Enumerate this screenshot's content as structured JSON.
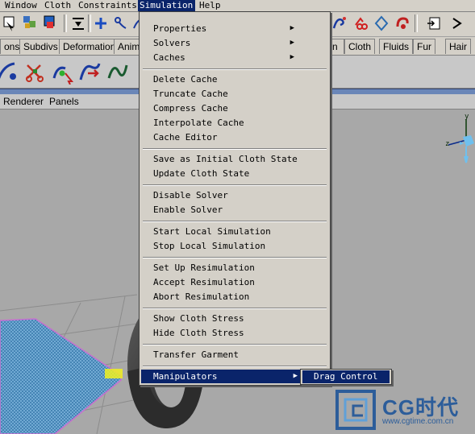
{
  "menubar": {
    "items": [
      "Window",
      "Cloth",
      "Constraints",
      "Simulation",
      "Help"
    ]
  },
  "shelf_tabs": [
    "ons",
    "Subdivs",
    "Deformation",
    "Anima",
    "n",
    "Cloth",
    "Fluids",
    "Fur",
    "Hair"
  ],
  "panel_menu": {
    "renderer": "Renderer",
    "panels": "Panels"
  },
  "simulation_menu": {
    "items": [
      {
        "label": "Properties",
        "submenu": true
      },
      {
        "label": "Solvers",
        "submenu": true
      },
      {
        "label": "Caches",
        "submenu": true
      },
      {
        "label": "Delete Cache"
      },
      {
        "label": "Truncate Cache"
      },
      {
        "label": "Compress Cache"
      },
      {
        "label": "Interpolate Cache"
      },
      {
        "label": "Cache Editor"
      },
      {
        "label": "Save as Initial Cloth State"
      },
      {
        "label": "Update Cloth State"
      },
      {
        "label": "Disable Solver"
      },
      {
        "label": "Enable Solver"
      },
      {
        "label": "Start Local Simulation"
      },
      {
        "label": "Stop Local Simulation"
      },
      {
        "label": "Set Up Resimulation"
      },
      {
        "label": "Accept Resimulation"
      },
      {
        "label": "Abort Resimulation"
      },
      {
        "label": "Show Cloth Stress"
      },
      {
        "label": "Hide Cloth Stress"
      },
      {
        "label": "Transfer Garment"
      },
      {
        "label": "Manipulators",
        "submenu": true,
        "highlighted": true
      }
    ],
    "submenu": {
      "label": "Drag Control"
    }
  },
  "view_axis": {
    "y": "y",
    "z": "z"
  },
  "watermark": {
    "brand": "CG时代",
    "url": "www.cgtime.com.cn"
  },
  "colors": {
    "menu_bg": "#d4d0c8",
    "highlight": "#0a246a",
    "viewport_bg": "#a8a8a8",
    "cloth_mesh": "#4a8ab8",
    "torus": "#3a3a3a"
  }
}
